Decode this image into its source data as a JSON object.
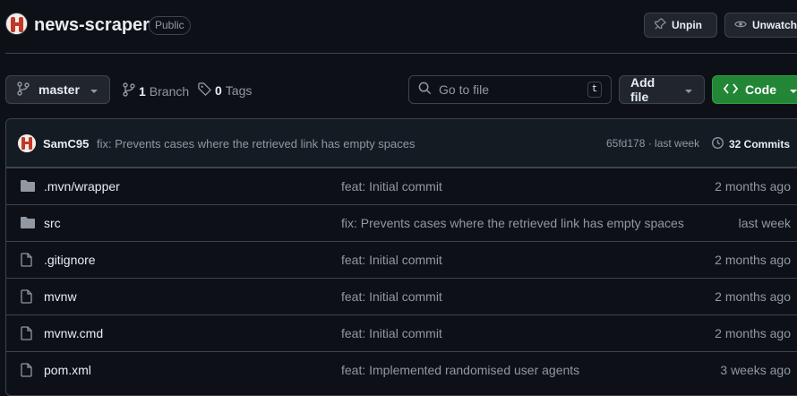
{
  "repo": {
    "name": "news-scraper",
    "visibility": "Public"
  },
  "header_actions": {
    "unpin_label": "Unpin",
    "unwatch_label": "Unwatch"
  },
  "toolbar": {
    "branch": "master",
    "branch_count": "1",
    "branch_label": "Branch",
    "tag_count": "0",
    "tag_label": "Tags",
    "search_placeholder": "Go to file",
    "search_shortcut": "t",
    "add_file_label": "Add file",
    "code_label": "Code"
  },
  "latest_commit": {
    "author": "SamC95",
    "message": "fix: Prevents cases where the retrieved link has empty spaces",
    "meta": "65fd178 · last week",
    "commits_count": "32 Commits"
  },
  "files": [
    {
      "name": ".mvn/wrapper",
      "type": "folder",
      "message": "feat: Initial commit",
      "date": "2 months ago"
    },
    {
      "name": "src",
      "type": "folder",
      "message": "fix: Prevents cases where the retrieved link has empty spaces",
      "date": "last week"
    },
    {
      "name": ".gitignore",
      "type": "file",
      "message": "feat: Initial commit",
      "date": "2 months ago"
    },
    {
      "name": "mvnw",
      "type": "file",
      "message": "feat: Initial commit",
      "date": "2 months ago"
    },
    {
      "name": "mvnw.cmd",
      "type": "file",
      "message": "feat: Initial commit",
      "date": "2 months ago"
    },
    {
      "name": "pom.xml",
      "type": "file",
      "message": "feat: Implemented randomised user agents",
      "date": "3 weeks ago"
    }
  ],
  "colors": {
    "background": "#0d1117",
    "border": "#3d444d",
    "muted": "#9198a1",
    "code_button": "#238636",
    "avatar_accent": "#c0392b"
  }
}
